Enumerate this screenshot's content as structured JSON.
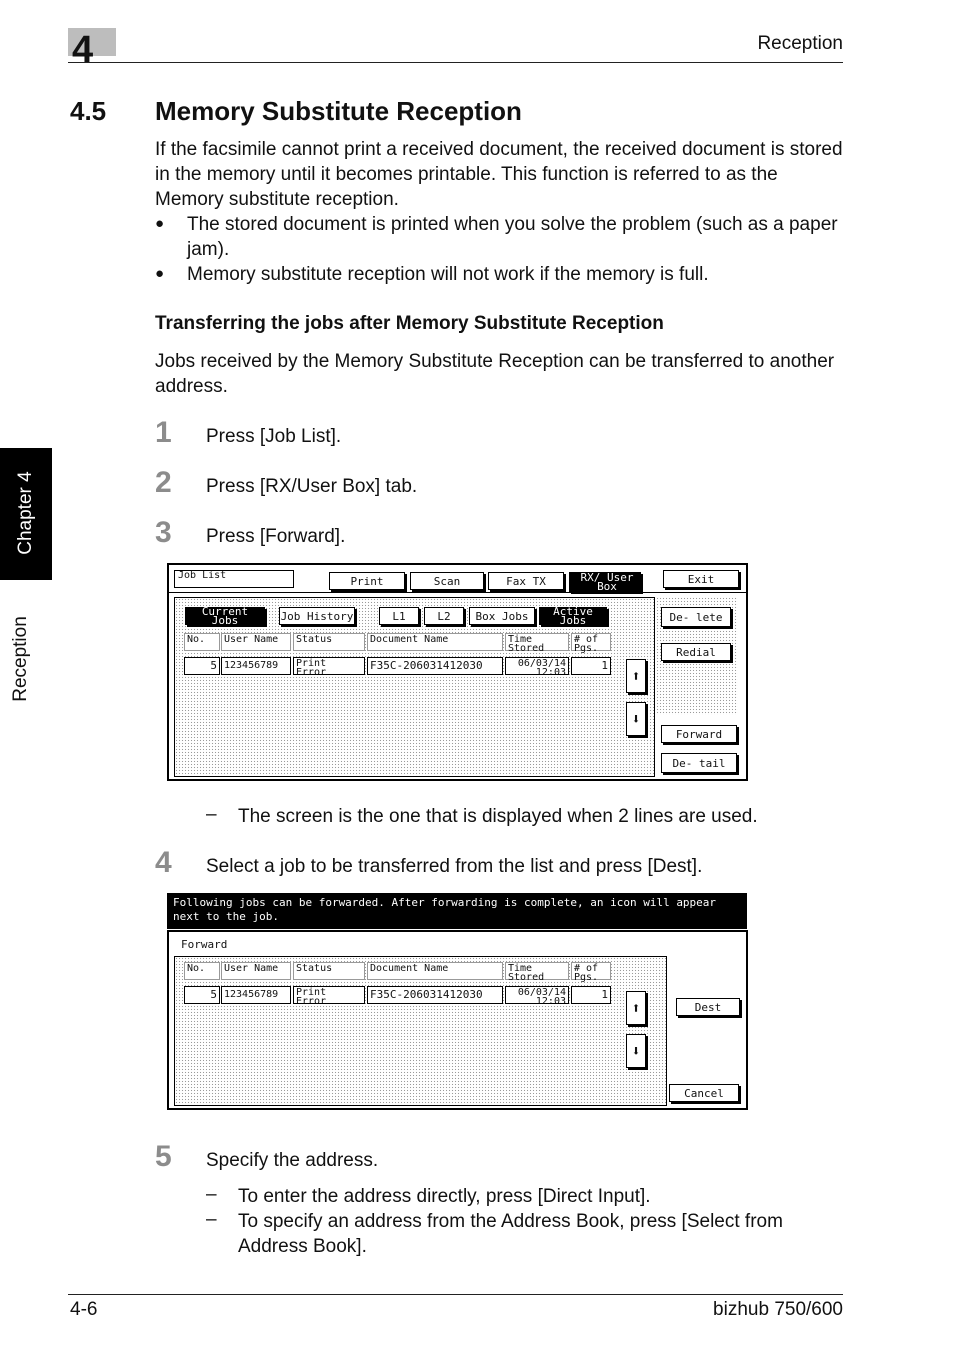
{
  "header": {
    "chapter_number": "4",
    "title": "Reception"
  },
  "section": {
    "number": "4.5",
    "title": "Memory Substitute Reception"
  },
  "intro": {
    "text": "If the facsimile cannot print a received document, the received document is stored in the memory until it becomes printable. This function is referred to as the Memory substitute reception.",
    "bullets": [
      "The stored document is printed when you solve the problem (such as a paper jam).",
      "Memory substitute reception will not work if the memory is full."
    ],
    "bullet_symbol": "●"
  },
  "subsection": {
    "title": "Transferring the jobs after Memory Substitute Reception",
    "text": "Jobs received by the Memory Substitute Reception can be transferred to another address."
  },
  "steps": [
    {
      "num": "1",
      "text": "Press [Job List]."
    },
    {
      "num": "2",
      "text": "Press [RX/User Box] tab."
    },
    {
      "num": "3",
      "text": "Press [Forward]."
    },
    {
      "num": "4",
      "text": "Select a job to be transferred from the list and press [Dest]."
    },
    {
      "num": "5",
      "text": "Specify the address."
    }
  ],
  "dash_symbol": "–",
  "notes": {
    "step3": "The screen is the one that is displayed when 2 lines are used.",
    "step5": [
      "To enter the address directly, press [Direct Input].",
      "To specify an address from the Address Book, press [Select from Address Book]."
    ]
  },
  "screen1": {
    "job_list": "Job List",
    "tabs": [
      "Print",
      "Scan",
      "Fax TX",
      "RX/ User Box"
    ],
    "exit": "Exit",
    "sub_tabs": [
      "Current Jobs",
      "Job History"
    ],
    "lines": [
      "L1",
      "L2",
      "Box Jobs",
      "Active Jobs"
    ],
    "headers": [
      "No.",
      "User Name",
      "Status",
      "Document Name",
      "Time Stored",
      "# of Pgs."
    ],
    "row": {
      "no": "5",
      "user": "123456789",
      "status": "Print Error",
      "doc": "F35C-206031412030",
      "time": "06/03/14 12:03",
      "pages": "1"
    },
    "delete": "De- lete",
    "redial": "Redial",
    "forward": "Forward",
    "detail": "De- tail",
    "up_icon": "arrow-up",
    "down_icon": "arrow-down"
  },
  "screen2": {
    "message": "Following jobs can be forwarded. After forwarding is complete, an icon will appear next to the job.",
    "label": "Forward",
    "headers": [
      "No.",
      "User Name",
      "Status",
      "Document Name",
      "Time Stored",
      "# of Pgs."
    ],
    "row": {
      "no": "5",
      "user": "123456789",
      "status": "Print Error",
      "doc": "F35C-206031412030",
      "time": "06/03/14 12:03",
      "pages": "1"
    },
    "dest": "Dest",
    "cancel": "Cancel"
  },
  "side_tab": {
    "chapter": "Chapter 4",
    "label": "Reception"
  },
  "footer": {
    "page": "4-6",
    "product": "bizhub 750/600"
  }
}
